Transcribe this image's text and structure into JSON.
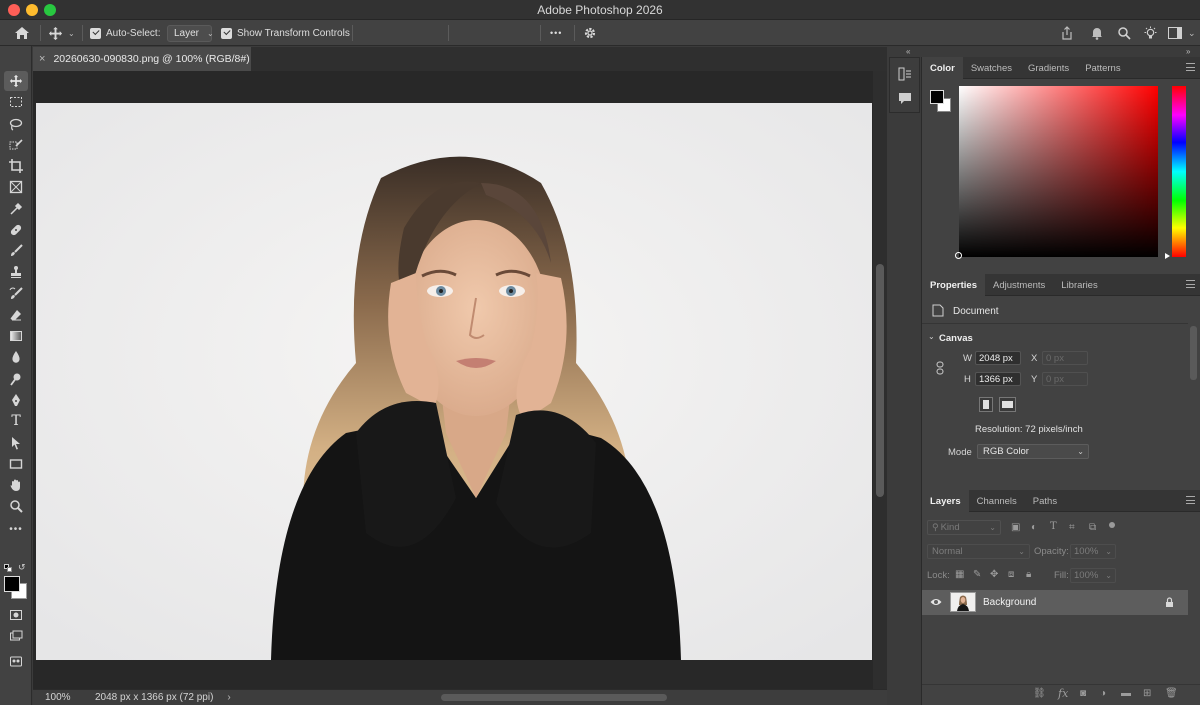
{
  "window": {
    "title": "Adobe Photoshop 2026"
  },
  "options_bar": {
    "auto_select_label": "Auto-Select:",
    "auto_select_target": "Layer",
    "show_transform_label": "Show Transform Controls",
    "more_label": "•••"
  },
  "document": {
    "tab_title": "20260630-090830.png @ 100% (RGB/8#)",
    "close_glyph": "×"
  },
  "status_bar": {
    "zoom": "100%",
    "info": "2048 px x 1366 px (72 ppi)",
    "arrow": "›"
  },
  "color_panel": {
    "tabs": [
      "Color",
      "Swatches",
      "Gradients",
      "Patterns"
    ],
    "foreground": "#000000",
    "background": "#ffffff",
    "hue_color": "#ff0000"
  },
  "properties_panel": {
    "tabs": [
      "Properties",
      "Adjustments",
      "Libraries"
    ],
    "document_label": "Document",
    "canvas_label": "Canvas",
    "w_label": "W",
    "w_value": "2048 px",
    "h_label": "H",
    "h_value": "1366 px",
    "x_label": "X",
    "x_placeholder": "0 px",
    "y_label": "Y",
    "y_placeholder": "0 px",
    "resolution": "Resolution: 72 pixels/inch",
    "mode_label": "Mode",
    "mode_value": "RGB Color"
  },
  "layers_panel": {
    "tabs": [
      "Layers",
      "Channels",
      "Paths"
    ],
    "filter_label": "Kind",
    "blend_mode": "Normal",
    "opacity_label": "Opacity:",
    "opacity_value": "100%",
    "lock_label": "Lock:",
    "fill_label": "Fill:",
    "fill_value": "100%",
    "layers": [
      {
        "name": "Background",
        "visible": true,
        "locked": true
      }
    ],
    "footer_fx": "fx"
  },
  "colors": {
    "accent": "#4a90e2",
    "panel_bg": "#424242",
    "workspace_bg": "#282828"
  }
}
